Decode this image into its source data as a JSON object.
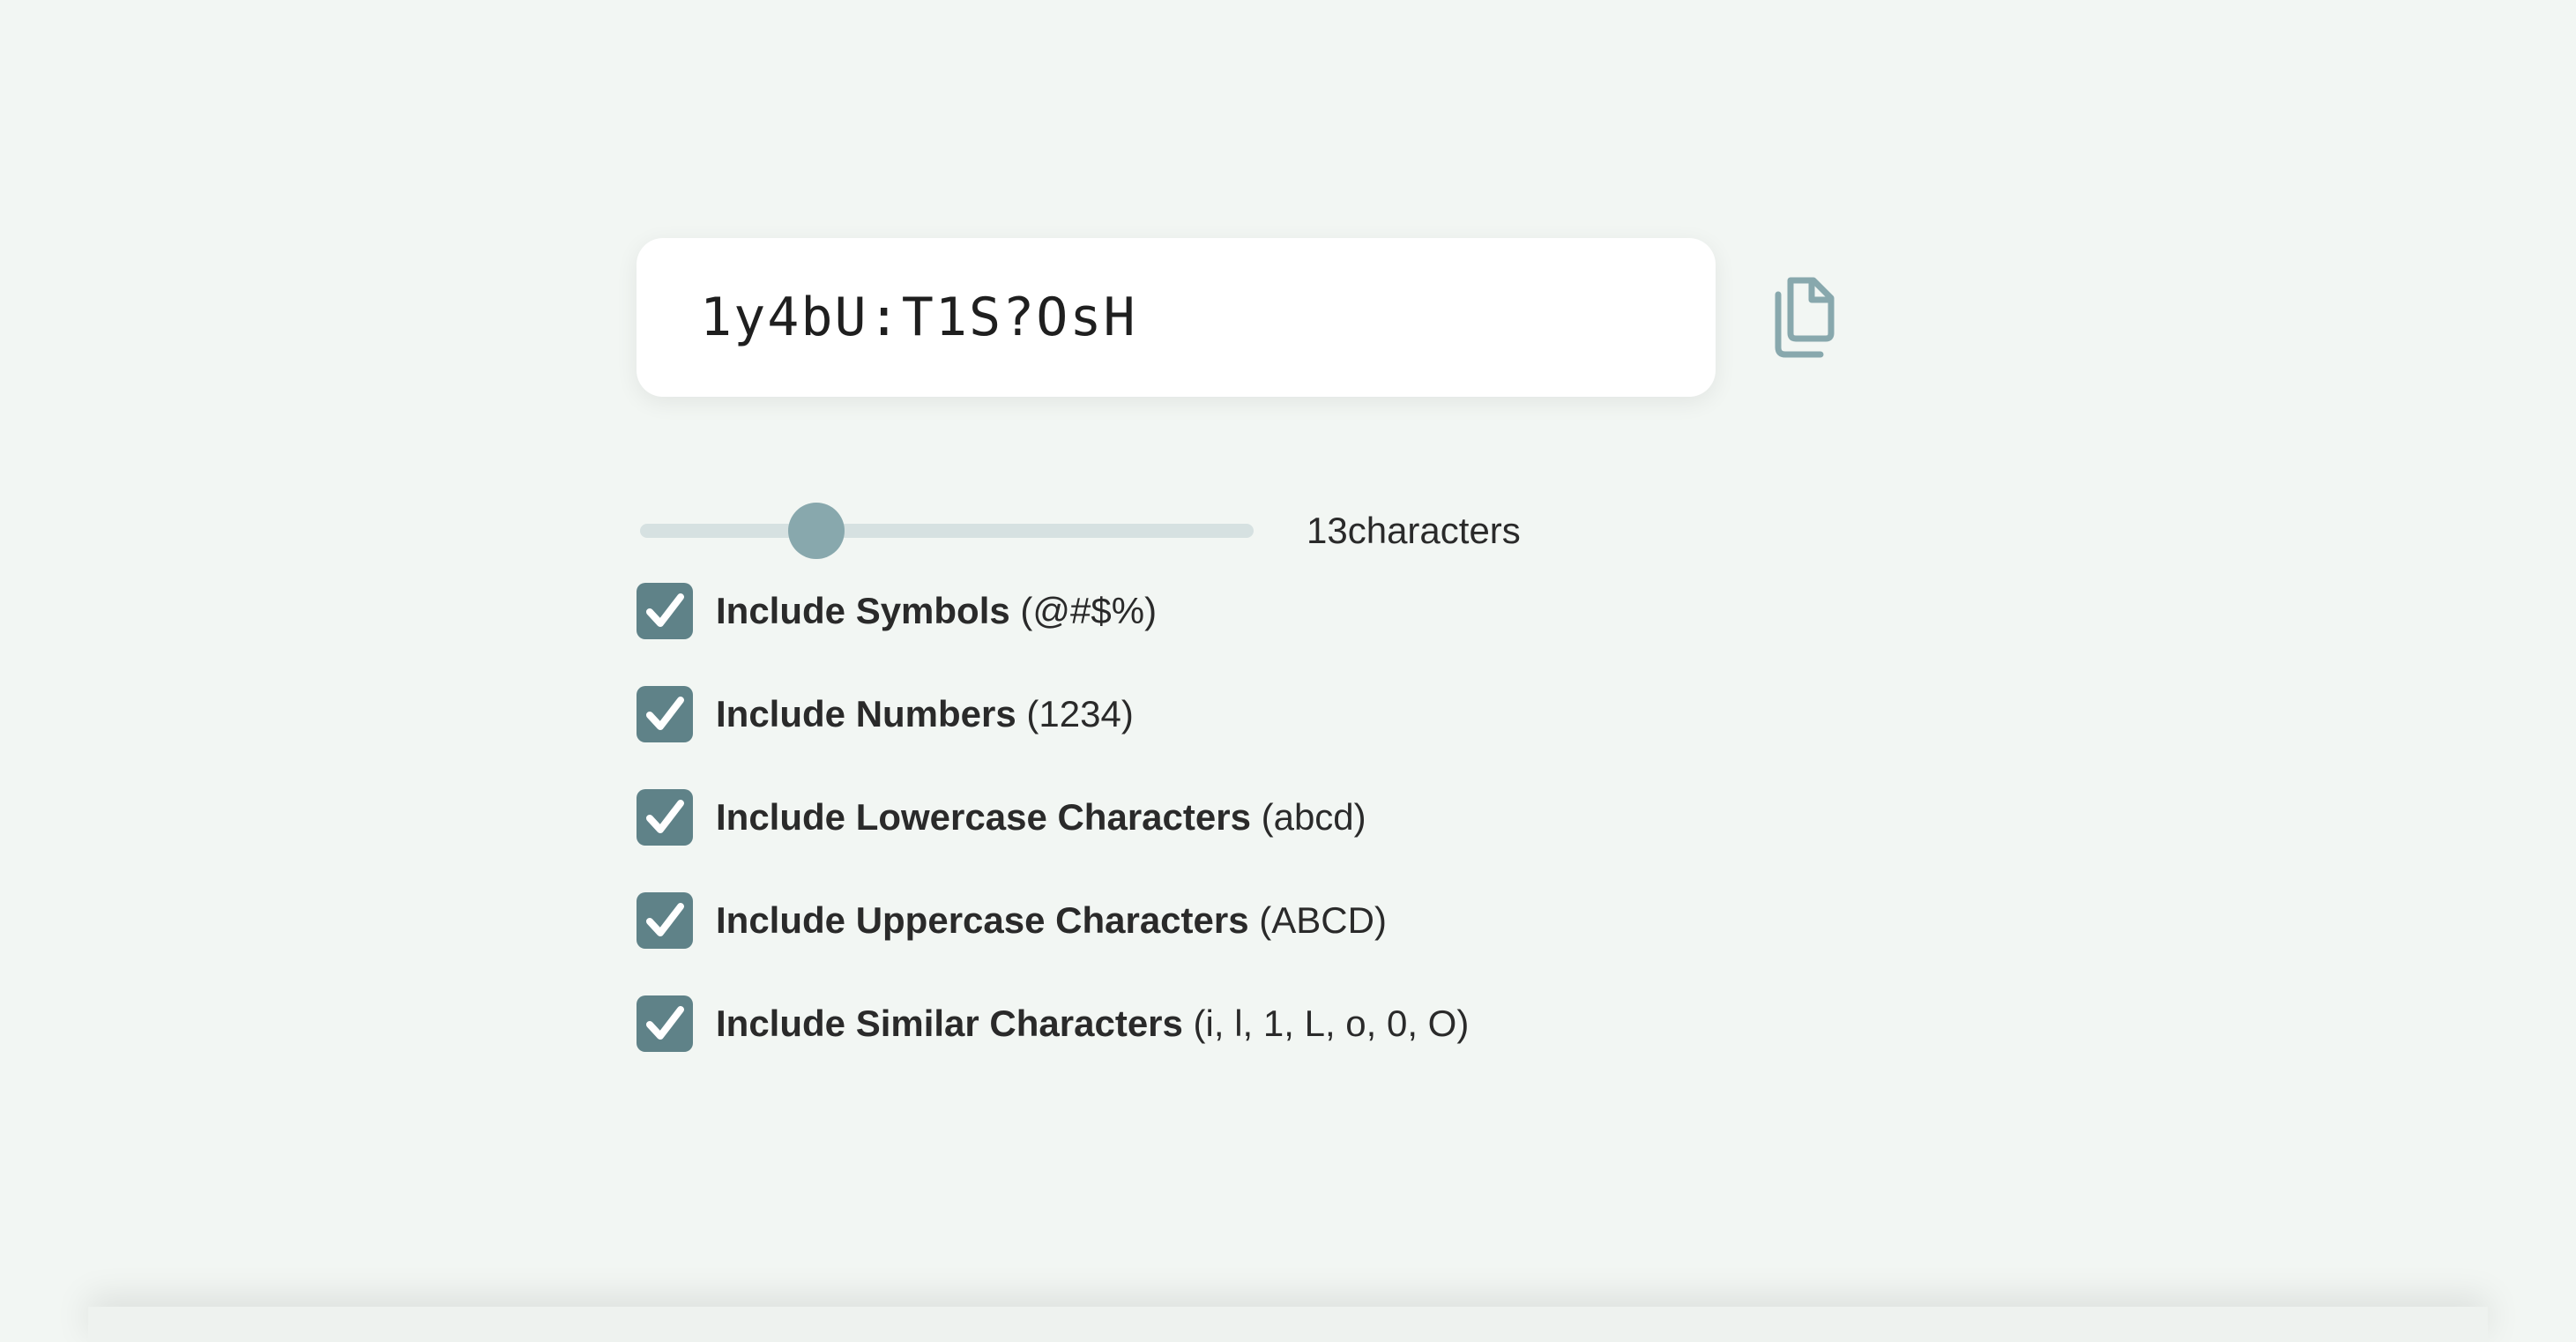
{
  "password": {
    "value": "1y4bU:T1S?OsH"
  },
  "copy_button": {
    "icon": "copy-icon"
  },
  "length": {
    "value": 13,
    "label": "13characters",
    "fraction": 0.29
  },
  "options": [
    {
      "bold": "Include Symbols",
      "detail": " (@#$%)",
      "checked": true
    },
    {
      "bold": "Include Numbers",
      "detail": " (1234)",
      "checked": true
    },
    {
      "bold": "Include Lowercase Characters",
      "detail": " (abcd)",
      "checked": true
    },
    {
      "bold": "Include Uppercase Characters",
      "detail": " (ABCD)",
      "checked": true
    },
    {
      "bold": "Include Similar Characters",
      "detail": " (i, l, 1, L, o, 0, O)",
      "checked": true
    }
  ],
  "colors": {
    "background": "#f2f6f3",
    "accent": "#5f8288",
    "slider_thumb": "#88a8ad",
    "slider_track": "#d6e1e1"
  }
}
